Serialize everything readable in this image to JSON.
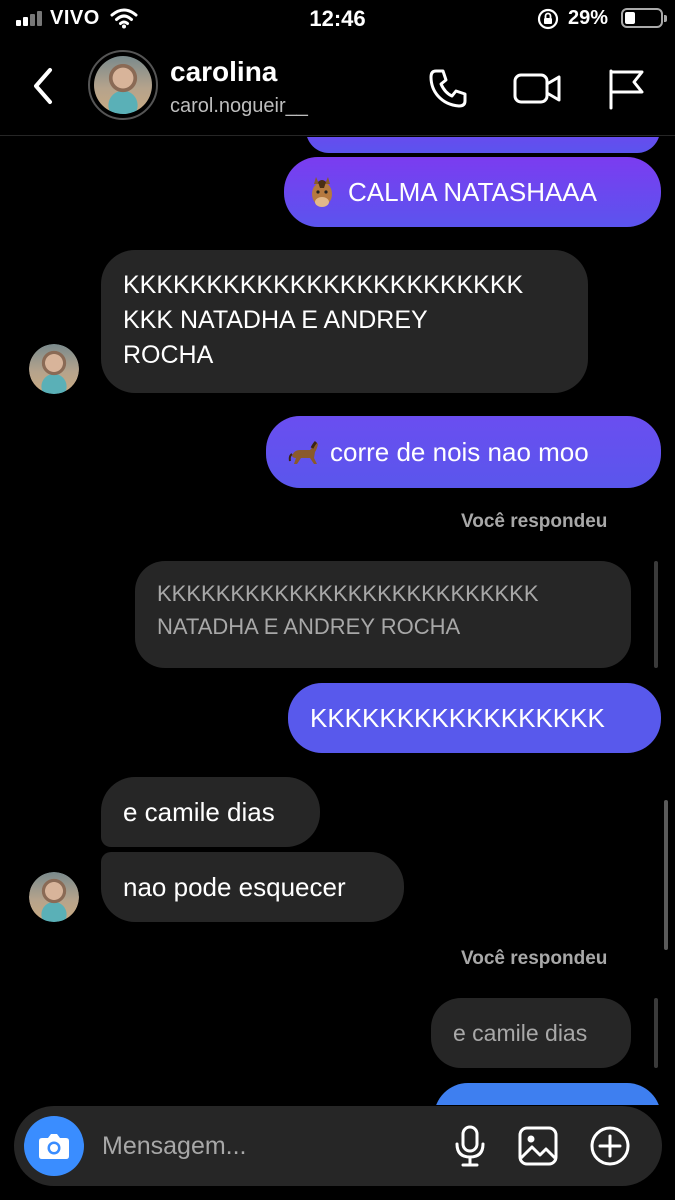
{
  "status_bar": {
    "carrier": "VIVO",
    "time": "12:46",
    "battery_percent": "29%",
    "battery_level": 0.29
  },
  "header": {
    "contact_name": "carolina",
    "contact_handle": "carol.nogueir__",
    "icons": [
      "back-chevron-icon",
      "phone-icon",
      "video-camera-icon",
      "flag-icon"
    ]
  },
  "messages": [
    {
      "side": "out",
      "emoji": "horse-face-emoji",
      "text": "CALMA NATASHAAA"
    },
    {
      "side": "in",
      "lines": [
        "KKKKKKKKKKKKKKKKKKKKKKKK",
        "KKK NATADHA E ANDREY",
        "ROCHA"
      ]
    },
    {
      "side": "out",
      "emoji": "horse-emoji",
      "text": "corre de nois nao moo"
    },
    {
      "side": "out",
      "reply_label": "Você respondeu",
      "quoted_lines": [
        "KKKKKKKKKKKKKKKKKKKKKKKKKK",
        "NATADHA E ANDREY ROCHA"
      ],
      "text": "KKKKKKKKKKKKKKKKK"
    },
    {
      "side": "in",
      "text": "e camile dias"
    },
    {
      "side": "in",
      "text": "nao pode esquecer"
    },
    {
      "side": "out",
      "reply_label": "Você respondeu",
      "quoted": "e camile dias"
    }
  ],
  "composer": {
    "placeholder": "Mensagem...",
    "icons": [
      "camera-icon",
      "microphone-icon",
      "image-gallery-icon",
      "add-circle-icon"
    ]
  },
  "colors": {
    "outgoing_bubble_top": "#7b3cf0",
    "outgoing_bubble_bottom": "#5859ec",
    "incoming_bubble": "#262626",
    "camera_button": "#3a8dff",
    "background": "#000000"
  }
}
